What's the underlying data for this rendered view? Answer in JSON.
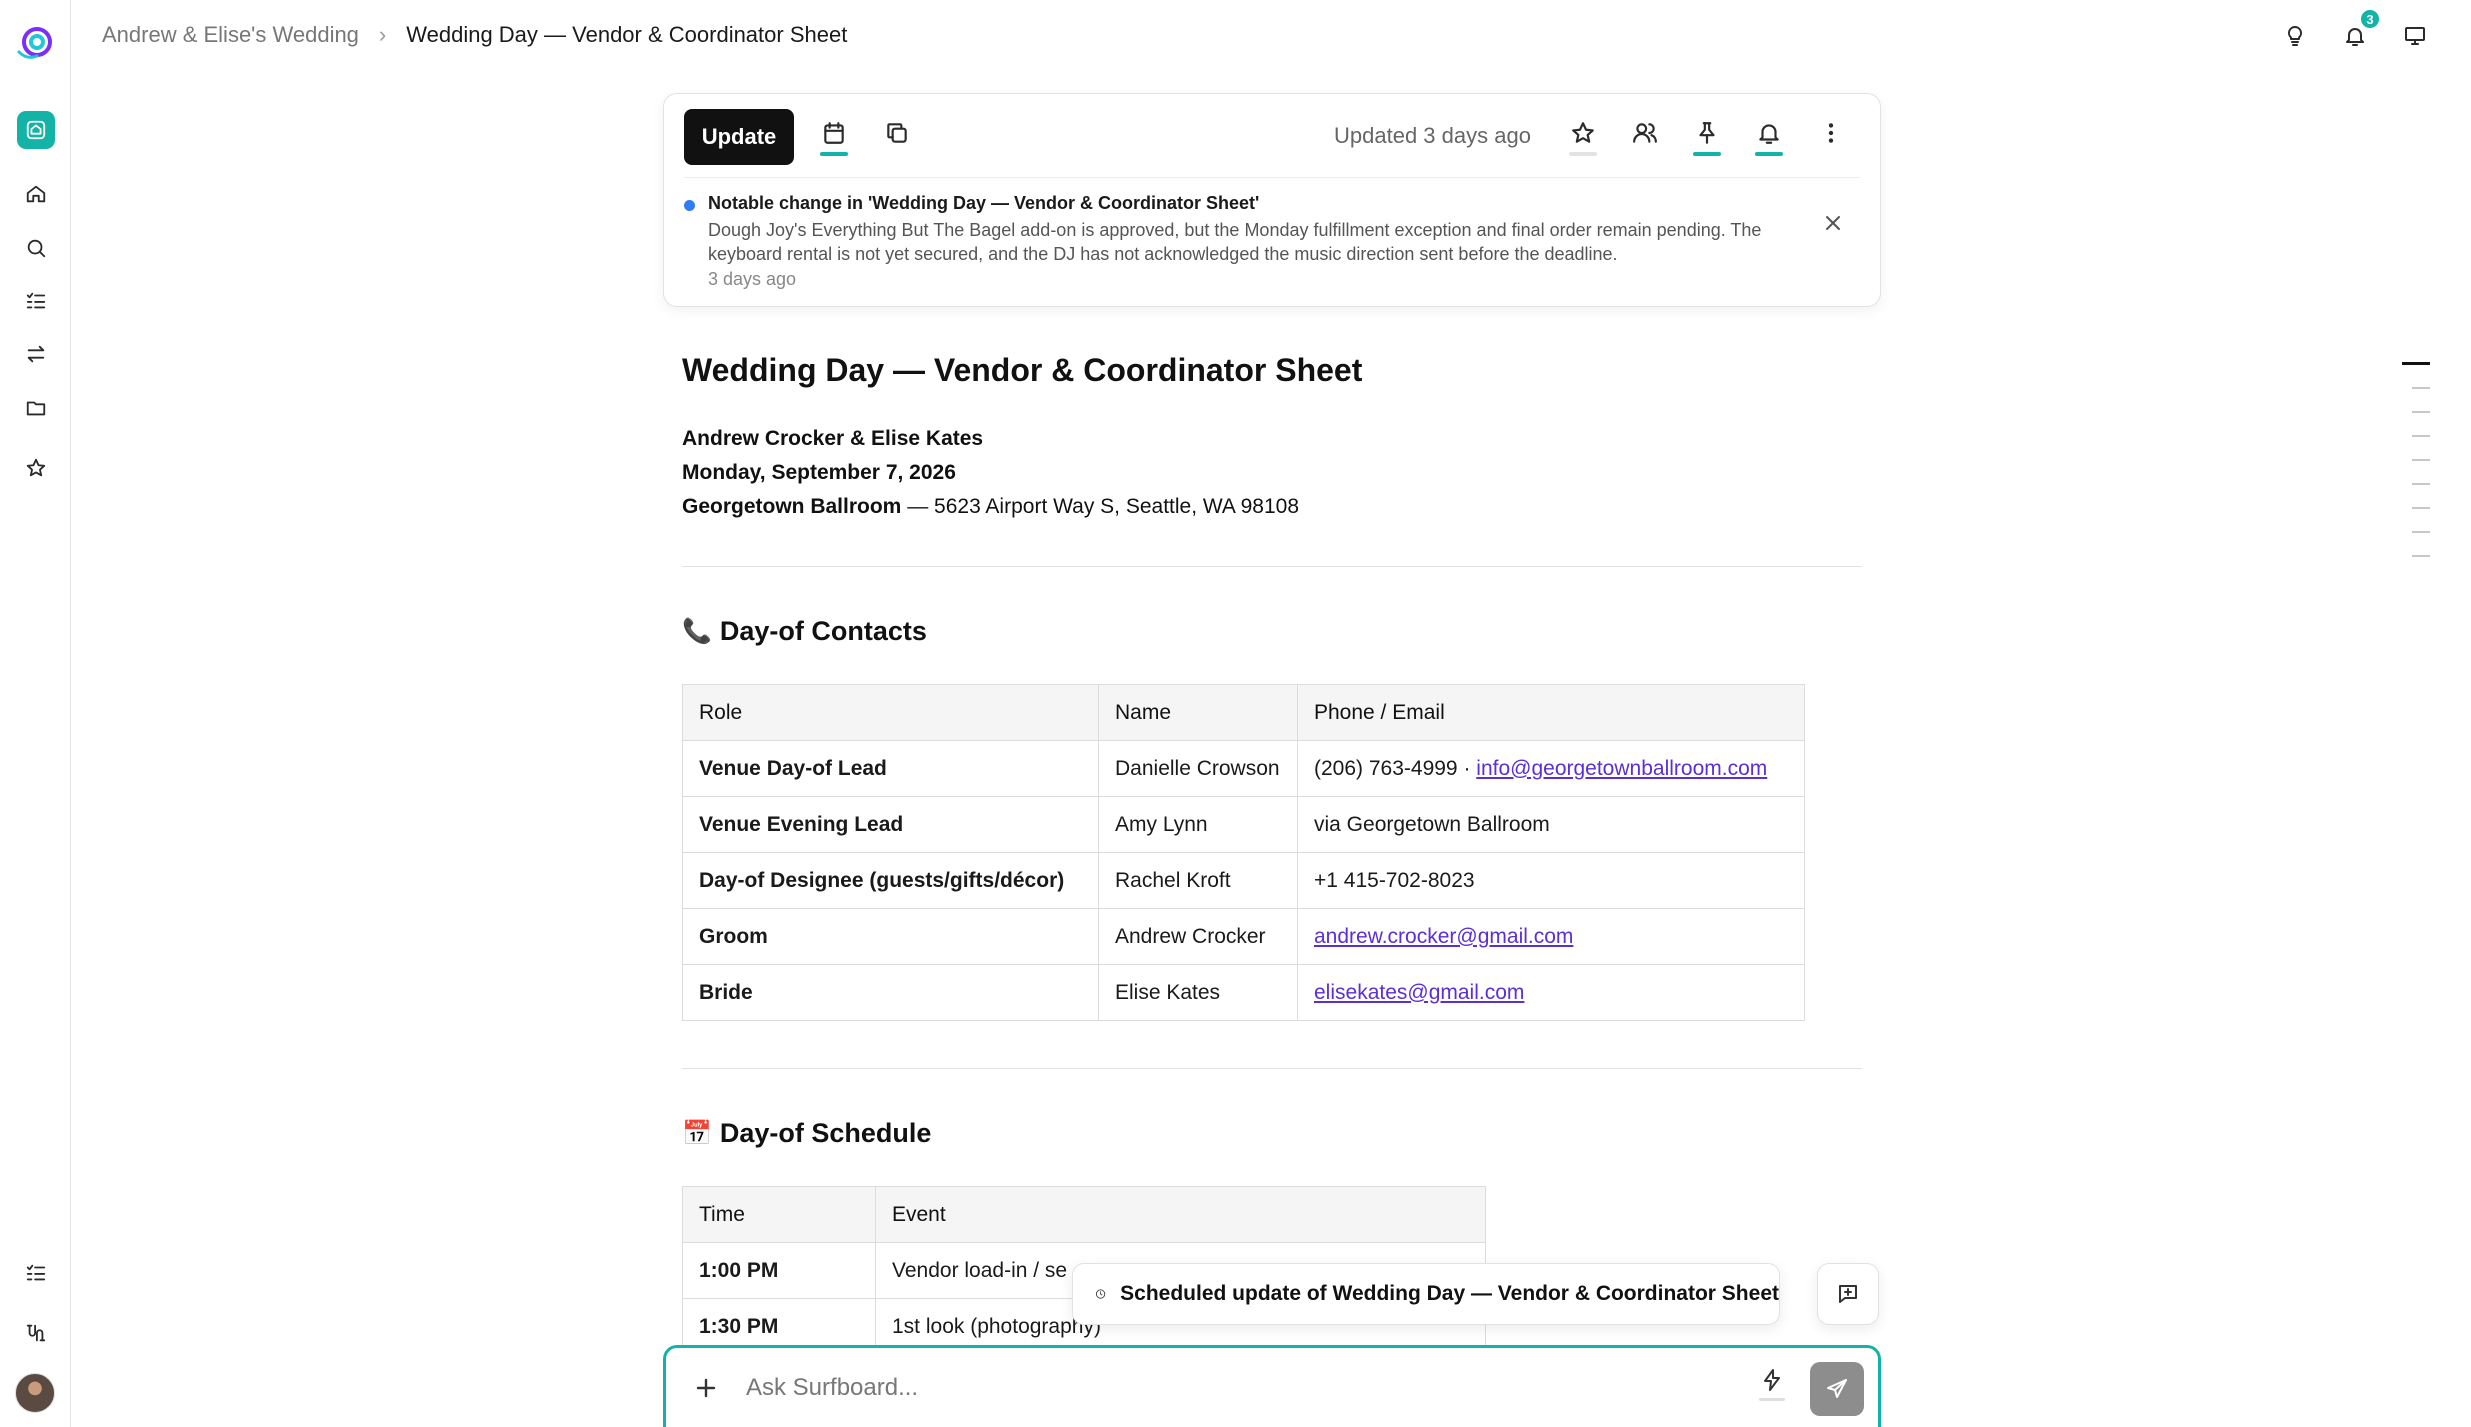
{
  "colors": {
    "accent": "#14b3a7",
    "link": "#5b2fd6",
    "notice_dot": "#2f7cf6"
  },
  "breadcrumb": {
    "parent": "Andrew & Elise's Wedding",
    "current": "Wedding Day — Vendor & Coordinator Sheet"
  },
  "topbar": {
    "notification_count": "3"
  },
  "toolbar": {
    "update_label": "Update",
    "updated_text": "Updated 3 days ago"
  },
  "notice": {
    "title": "Notable change in 'Wedding Day — Vendor & Coordinator Sheet'",
    "body": "Dough Joy's Everything But The Bagel add-on is approved, but the Monday fulfillment exception and final order remain pending. The keyboard rental is not yet secured, and the DJ has not acknowledged the music direction sent before the deadline.",
    "time": "3 days ago"
  },
  "doc": {
    "title": "Wedding Day — Vendor & Coordinator Sheet",
    "couple": "Andrew Crocker & Elise Kates",
    "date": "Monday, September 7, 2026",
    "venue_name": "Georgetown Ballroom",
    "venue_address": " — 5623 Airport Way S, Seattle, WA 98108"
  },
  "contacts": {
    "emoji": "📞",
    "heading": "Day-of Contacts",
    "headers": [
      "Role",
      "Name",
      "Phone / Email"
    ],
    "rows": [
      {
        "role": "Venue Day-of Lead",
        "name": "Danielle Crowson",
        "phone": "(206) 763-4999 · ",
        "email": "info@georgetownballroom.com"
      },
      {
        "role": "Venue Evening Lead",
        "name": "Amy Lynn",
        "phone": "via Georgetown Ballroom",
        "email": ""
      },
      {
        "role": "Day-of Designee (guests/gifts/décor)",
        "name": "Rachel Kroft",
        "phone": "+1 415-702-8023",
        "email": ""
      },
      {
        "role": "Groom",
        "name": "Andrew Crocker",
        "phone": "",
        "email": "andrew.crocker@gmail.com"
      },
      {
        "role": "Bride",
        "name": "Elise Kates",
        "phone": "",
        "email": "elisekates@gmail.com"
      }
    ]
  },
  "schedule": {
    "emoji": "📅",
    "heading": "Day-of Schedule",
    "headers": [
      "Time",
      "Event"
    ],
    "rows": [
      {
        "time": "1:00 PM",
        "event": "Vendor load-in / se"
      },
      {
        "time": "1:30 PM",
        "event": "1st look (photography)"
      }
    ]
  },
  "scheduled_chip": {
    "text": "Scheduled update of Wedding Day — Vendor & Coordinator Sheet"
  },
  "composer": {
    "placeholder": "Ask Surfboard..."
  }
}
